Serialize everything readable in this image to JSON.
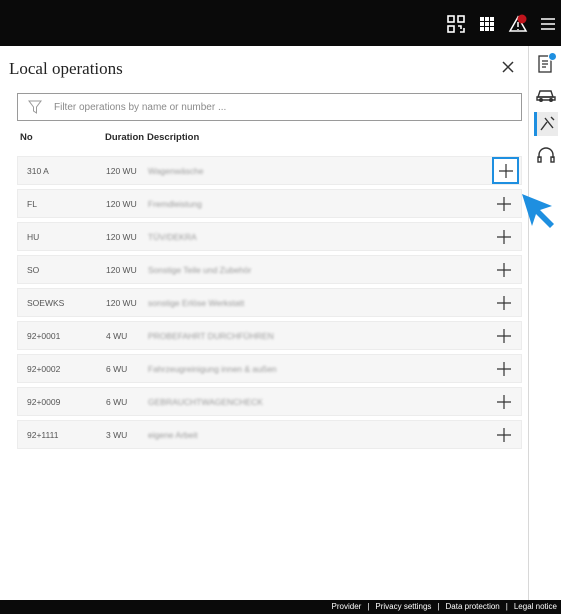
{
  "panel": {
    "title": "Local operations",
    "filter_placeholder": "Filter operations by name or number ..."
  },
  "table": {
    "headers": {
      "no": "No",
      "duration": "Duration",
      "description": "Description"
    },
    "rows": [
      {
        "no": "310 A",
        "duration": "120 WU",
        "description": "Wagenwäsche"
      },
      {
        "no": "FL",
        "duration": "120 WU",
        "description": "Fremdleistung"
      },
      {
        "no": "HU",
        "duration": "120 WU",
        "description": "TÜV/DEKRA"
      },
      {
        "no": "SO",
        "duration": "120 WU",
        "description": "Sonstige Teile und Zubehör"
      },
      {
        "no": "SOEWKS",
        "duration": "120 WU",
        "description": "sonstige Erlöse Werkstatt"
      },
      {
        "no": "92+0001",
        "duration": "4 WU",
        "description": "PROBEFAHRT DURCHFÜHREN"
      },
      {
        "no": "92+0002",
        "duration": "6 WU",
        "description": "Fahrzeugreinigung innen & außen"
      },
      {
        "no": "92+0009",
        "duration": "6 WU",
        "description": "GEBRAUCHTWAGENCHECK"
      },
      {
        "no": "92+1111",
        "duration": "3 WU",
        "description": "eigene Arbeit"
      }
    ]
  },
  "footer": {
    "provider": "Provider",
    "privacy": "Privacy settings",
    "data_protection": "Data protection",
    "legal": "Legal notice",
    "separator": "|"
  },
  "colors": {
    "accent": "#1e8fe0",
    "topbar": "#0a0a0a",
    "alert": "#c0141c"
  },
  "icons": {
    "topbar": [
      "qr-scan-icon",
      "grid-apps-icon",
      "warning-icon",
      "menu-icon"
    ],
    "sidebar": [
      "document-icon",
      "car-icon",
      "tools-icon",
      "headset-icon"
    ]
  }
}
